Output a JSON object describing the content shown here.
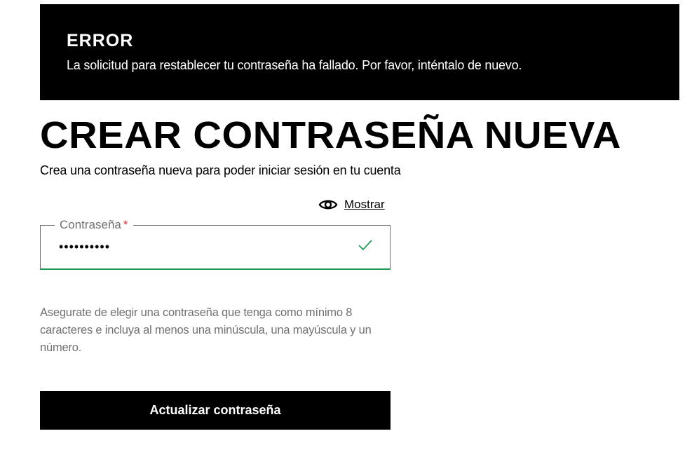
{
  "error": {
    "title": "ERROR",
    "message": "La solicitud para restablecer tu contraseña ha fallado. Por favor, inténtalo de nuevo."
  },
  "page": {
    "title": "CREAR CONTRASEÑA NUEVA",
    "subtitle": "Crea una contraseña nueva para poder iniciar sesión en tu cuenta"
  },
  "password_field": {
    "label": "Contraseña",
    "required_marker": "*",
    "value": "••••••••••",
    "show_label": "Mostrar",
    "show_icon": "eye-icon",
    "valid_icon": "check-icon"
  },
  "hint": "Asegurate de elegir una contraseña que tenga como mínimo 8 caracteres e incluya al menos una minúscula, una mayúscula y un número.",
  "submit": {
    "label": "Actualizar contraseña"
  },
  "colors": {
    "banner_bg": "#000000",
    "valid": "#1e9c55",
    "required": "#d32f2f",
    "muted_text": "#707070"
  }
}
